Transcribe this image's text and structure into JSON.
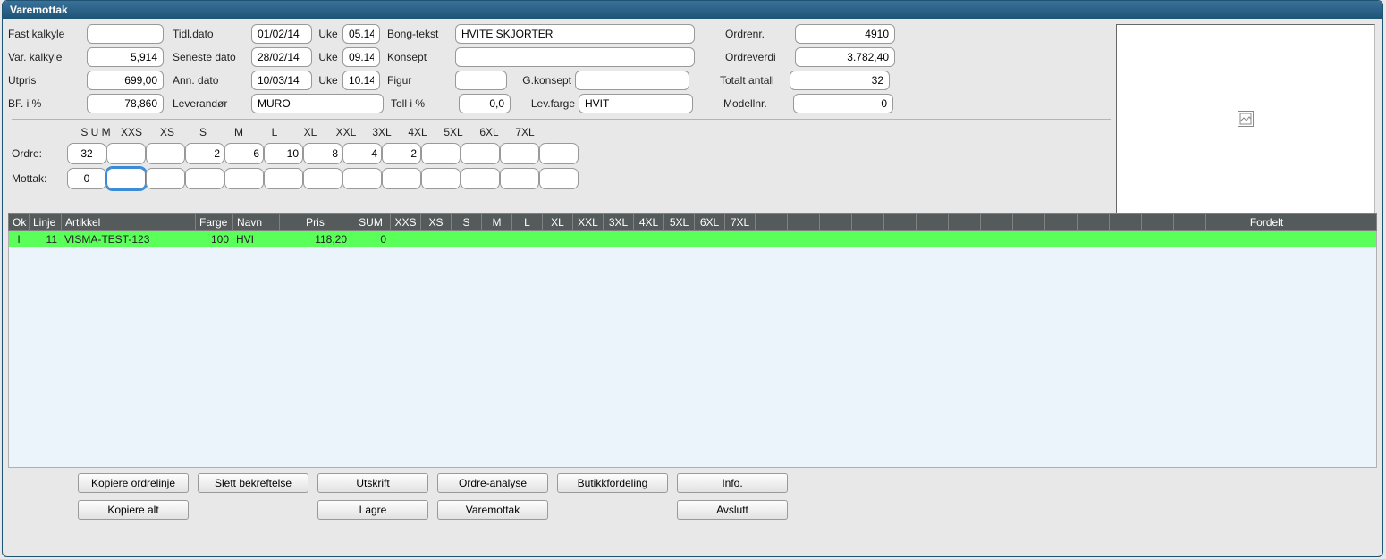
{
  "window": {
    "title": "Varemottak"
  },
  "labels": {
    "fast_kalkyle": "Fast kalkyle",
    "var_kalkyle": "Var. kalkyle",
    "utpris": "Utpris",
    "bf_pct": "BF. i %",
    "tidl_dato": "Tidl.dato",
    "seneste_dato": "Seneste dato",
    "ann_dato": "Ann. dato",
    "leverandor": "Leverandør",
    "uke": "Uke",
    "bong_tekst": "Bong-tekst",
    "konsept": "Konsept",
    "figur": "Figur",
    "g_konsept": "G.konsept",
    "toll_pct": "Toll i %",
    "lev_farge": "Lev.farge",
    "ordrenr": "Ordrenr.",
    "ordreverdi": "Ordreverdi",
    "total_antall": "Totalt antall",
    "modellnr": "Modellnr.",
    "ordre": "Ordre:",
    "mottak": "Mottak:"
  },
  "values": {
    "fast_kalkyle": "",
    "var_kalkyle": "5,914",
    "utpris": "699,00",
    "bf_pct": "78,860",
    "tidl_dato": "01/02/14",
    "tidl_uke": "05.14",
    "seneste_dato": "28/02/14",
    "seneste_uke": "09.14",
    "ann_dato": "10/03/14",
    "ann_uke": "10.14",
    "leverandor": "MURO",
    "bong_tekst": "HVITE SKJORTER",
    "konsept": "",
    "figur": "",
    "g_konsept": "",
    "toll_pct": "0,0",
    "lev_farge": "HVIT",
    "ordrenr": "4910",
    "ordreverdi": "3.782,40",
    "total_antall": "32",
    "modellnr": "0"
  },
  "sizes": {
    "headers": [
      "S U M",
      "XXS",
      "XS",
      "S",
      "M",
      "L",
      "XL",
      "XXL",
      "3XL",
      "4XL",
      "5XL",
      "6XL",
      "7XL"
    ],
    "ordre": [
      "32",
      "",
      "",
      "2",
      "6",
      "10",
      "8",
      "4",
      "2",
      "",
      "",
      "",
      ""
    ],
    "mottak": [
      "0",
      "",
      "",
      "",
      "",
      "",
      "",
      "",
      "",
      "",
      "",
      "",
      ""
    ],
    "mottak_selected_index": 1
  },
  "grid": {
    "headers": [
      "Ok",
      "Linje",
      "Artikkel",
      "Farge",
      "Navn",
      "Pris",
      "SUM",
      "XXS",
      "XS",
      "S",
      "M",
      "L",
      "XL",
      "XXL",
      "3XL",
      "4XL",
      "5XL",
      "6XL",
      "7XL"
    ],
    "fordelt": "Fordelt",
    "rows": [
      {
        "ok": "I",
        "linje": "11",
        "artikkel": "VISMA-TEST-123",
        "farge": "100",
        "navn": "HVI",
        "pris": "118,20",
        "sum": "0",
        "sz": [
          "",
          "",
          "",
          "",
          "",
          "",
          "",
          "",
          "",
          "",
          "",
          ""
        ]
      }
    ]
  },
  "buttons": {
    "kopiere_ordrelinje": "Kopiere ordrelinje",
    "slett_bekreftelse": "Slett bekreftelse",
    "utskrift": "Utskrift",
    "ordre_analyse": "Ordre-analyse",
    "butikkfordeling": "Butikkfordeling",
    "info": "Info.",
    "kopiere_alt": "Kopiere alt",
    "lagre": "Lagre",
    "varemottak": "Varemottak",
    "avslutt": "Avslutt"
  }
}
